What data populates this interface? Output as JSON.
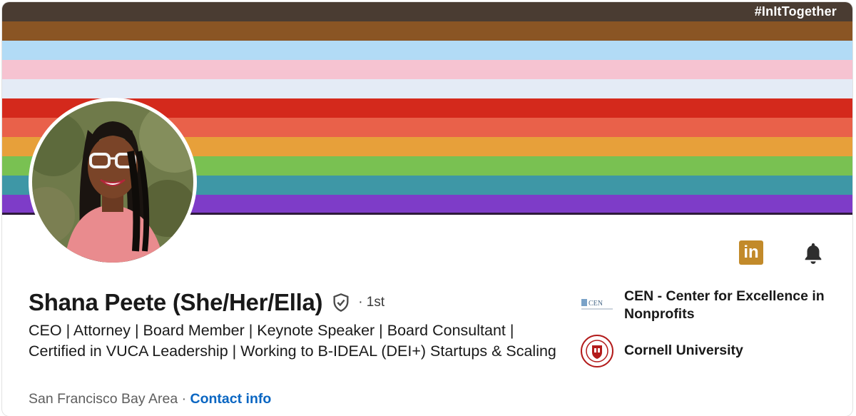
{
  "banner": {
    "hashtag": "#InItTogether"
  },
  "profile": {
    "name": "Shana Peete (She/Her/Ella)",
    "degree": "· 1st",
    "headline": "CEO | Attorney | Board Member | Keynote Speaker | Board Consultant | Certified in VUCA Leadership | Working to B-IDEAL (DEI+) Startups & Scaling",
    "location": "San Francisco Bay Area",
    "separator": "·",
    "contact_label": "Contact info"
  },
  "actions": {
    "linkedin_icon_text": "in"
  },
  "orgs": [
    {
      "name": "CEN - Center for Excellence in Nonprofits",
      "logo_text": "CEN"
    },
    {
      "name": "Cornell University"
    }
  ],
  "colors": {
    "stripes": [
      "#4a3c32",
      "#8a5524",
      "#b2dbf6",
      "#f6c3d1",
      "#e4ebf6",
      "#d4291c",
      "#e9614a",
      "#e7a03a",
      "#79c152",
      "#3e97a6",
      "#7e3cc8"
    ],
    "linkedin_gold": "#c28a2a",
    "link_blue": "#0a66c2"
  }
}
